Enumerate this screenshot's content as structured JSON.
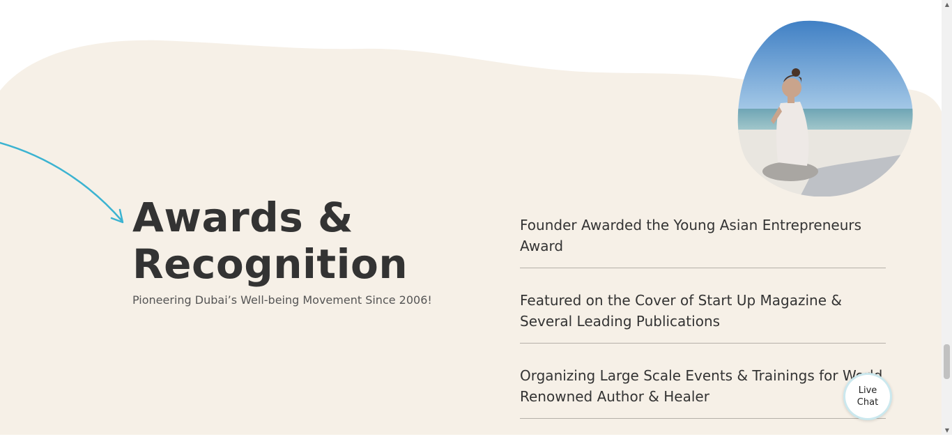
{
  "heading": {
    "line1": "Awards &",
    "line2": "Recognition"
  },
  "subtitle": "Pioneering Dubai’s Well-being Movement Since 2006!",
  "awards": [
    "Founder Awarded the Young Asian Entrepreneurs Award",
    "Featured on the Cover of Start Up Magazine & Several Leading Publications",
    "Organizing Large Scale Events & Trainings for World Renowned Author & Healer"
  ],
  "live_chat": {
    "line1": "Live",
    "line2": "Chat"
  },
  "colors": {
    "background": "#f6f0e7",
    "accent": "#3bb3d1",
    "text": "#333333"
  },
  "images": {
    "photo": "woman-meditating-on-beach"
  }
}
